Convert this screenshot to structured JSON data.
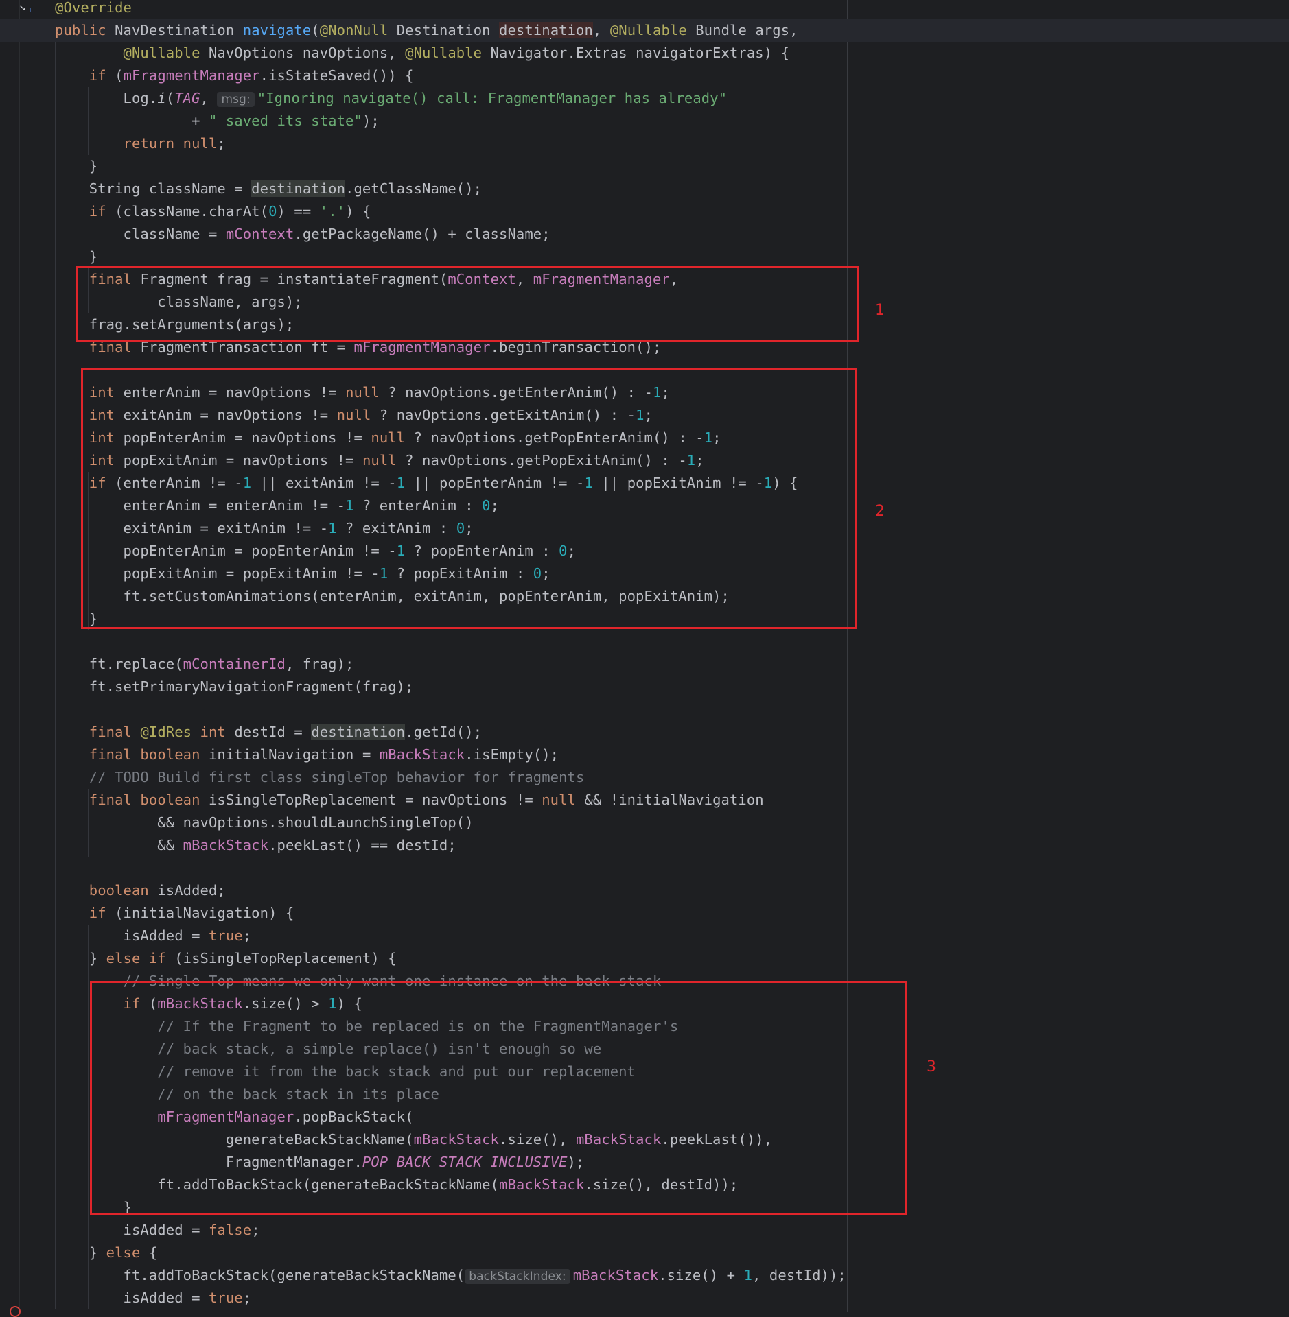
{
  "editor": {
    "gutter_icon": "override-implements-icon",
    "error_marker_icon": "error-marker-icon",
    "colors": {
      "background": "#1e1f22",
      "keyword": "#cf8e6d",
      "method": "#56a8f5",
      "annotation": "#b3ae60",
      "field": "#c77dbb",
      "string": "#6aab73",
      "number": "#2aacb8",
      "comment": "#7a7e85",
      "annotation_box": "#e0252b"
    },
    "lines": [
      {
        "tokens": [
          {
            "t": "@Override",
            "c": "an"
          }
        ]
      },
      {
        "current": true,
        "tokens": [
          {
            "t": "public ",
            "c": "kw"
          },
          {
            "t": "NavDestination "
          },
          {
            "t": "navigate",
            "c": "fn"
          },
          {
            "t": "("
          },
          {
            "t": "@NonNull",
            "c": "an"
          },
          {
            "t": " Destination "
          },
          {
            "t": "destin",
            "c": "hl-err"
          },
          {
            "caret": true
          },
          {
            "t": "ation",
            "c": "hl-err"
          },
          {
            "t": ", "
          },
          {
            "t": "@Nullable",
            "c": "an"
          },
          {
            "t": " Bundle args,"
          }
        ]
      },
      {
        "tokens": [
          {
            "t": "        "
          },
          {
            "t": "@Nullable",
            "c": "an"
          },
          {
            "t": " NavOptions navOptions, "
          },
          {
            "t": "@Nullable",
            "c": "an"
          },
          {
            "t": " Navigator.Extras navigatorExtras) {"
          }
        ]
      },
      {
        "tokens": [
          {
            "t": "    "
          },
          {
            "t": "if",
            "c": "kw"
          },
          {
            "t": " ("
          },
          {
            "t": "mFragmentManager",
            "c": "fld"
          },
          {
            "t": ".isStateSaved()) {"
          }
        ]
      },
      {
        "tokens": [
          {
            "t": "        Log."
          },
          {
            "t": "i",
            "c": "it"
          },
          {
            "t": "("
          },
          {
            "t": "TAG",
            "c": "fld it"
          },
          {
            "t": ", "
          },
          {
            "hint": "msg:"
          },
          {
            "t": "\"Ignoring navigate() call: FragmentManager has already\"",
            "c": "st"
          }
        ]
      },
      {
        "tokens": [
          {
            "t": "                + "
          },
          {
            "t": "\" saved its state\"",
            "c": "st"
          },
          {
            "t": ");"
          }
        ]
      },
      {
        "tokens": [
          {
            "t": "        "
          },
          {
            "t": "return null",
            "c": "kw"
          },
          {
            "t": ";"
          }
        ]
      },
      {
        "tokens": [
          {
            "t": "    }"
          }
        ]
      },
      {
        "tokens": [
          {
            "t": "    String className = "
          },
          {
            "t": "destination",
            "c": "hl"
          },
          {
            "t": ".getClassName();"
          }
        ]
      },
      {
        "tokens": [
          {
            "t": "    "
          },
          {
            "t": "if",
            "c": "kw"
          },
          {
            "t": " (className.charAt("
          },
          {
            "t": "0",
            "c": "num"
          },
          {
            "t": ") == "
          },
          {
            "t": "'.'",
            "c": "st"
          },
          {
            "t": ") {"
          }
        ]
      },
      {
        "tokens": [
          {
            "t": "        className = "
          },
          {
            "t": "mContext",
            "c": "fld"
          },
          {
            "t": ".getPackageName() + className;"
          }
        ]
      },
      {
        "tokens": [
          {
            "t": "    }"
          }
        ]
      },
      {
        "tokens": [
          {
            "t": "    "
          },
          {
            "t": "final ",
            "c": "kw"
          },
          {
            "t": "Fragment frag = instantiateFragment("
          },
          {
            "t": "mContext",
            "c": "fld"
          },
          {
            "t": ", "
          },
          {
            "t": "mFragmentManager",
            "c": "fld"
          },
          {
            "t": ","
          }
        ]
      },
      {
        "tokens": [
          {
            "t": "            className, args);"
          }
        ]
      },
      {
        "tokens": [
          {
            "t": "    frag.setArguments(args);"
          }
        ]
      },
      {
        "tokens": [
          {
            "t": "    "
          },
          {
            "t": "final ",
            "c": "kw"
          },
          {
            "t": "FragmentTransaction ft = "
          },
          {
            "t": "mFragmentManager",
            "c": "fld"
          },
          {
            "t": ".beginTransaction();"
          }
        ]
      },
      {
        "tokens": []
      },
      {
        "tokens": [
          {
            "t": "    "
          },
          {
            "t": "int ",
            "c": "kw"
          },
          {
            "t": "enterAnim = navOptions != "
          },
          {
            "t": "null",
            "c": "kw"
          },
          {
            "t": " ? navOptions.getEnterAnim() : -"
          },
          {
            "t": "1",
            "c": "num"
          },
          {
            "t": ";"
          }
        ]
      },
      {
        "tokens": [
          {
            "t": "    "
          },
          {
            "t": "int ",
            "c": "kw"
          },
          {
            "t": "exitAnim = navOptions != "
          },
          {
            "t": "null",
            "c": "kw"
          },
          {
            "t": " ? navOptions.getExitAnim() : -"
          },
          {
            "t": "1",
            "c": "num"
          },
          {
            "t": ";"
          }
        ]
      },
      {
        "tokens": [
          {
            "t": "    "
          },
          {
            "t": "int ",
            "c": "kw"
          },
          {
            "t": "popEnterAnim = navOptions != "
          },
          {
            "t": "null",
            "c": "kw"
          },
          {
            "t": " ? navOptions.getPopEnterAnim() : -"
          },
          {
            "t": "1",
            "c": "num"
          },
          {
            "t": ";"
          }
        ]
      },
      {
        "tokens": [
          {
            "t": "    "
          },
          {
            "t": "int ",
            "c": "kw"
          },
          {
            "t": "popExitAnim = navOptions != "
          },
          {
            "t": "null",
            "c": "kw"
          },
          {
            "t": " ? navOptions.getPopExitAnim() : -"
          },
          {
            "t": "1",
            "c": "num"
          },
          {
            "t": ";"
          }
        ]
      },
      {
        "tokens": [
          {
            "t": "    "
          },
          {
            "t": "if",
            "c": "kw"
          },
          {
            "t": " (enterAnim != -"
          },
          {
            "t": "1",
            "c": "num"
          },
          {
            "t": " || exitAnim != -"
          },
          {
            "t": "1",
            "c": "num"
          },
          {
            "t": " || popEnterAnim != -"
          },
          {
            "t": "1",
            "c": "num"
          },
          {
            "t": " || popExitAnim != -"
          },
          {
            "t": "1",
            "c": "num"
          },
          {
            "t": ") {"
          }
        ]
      },
      {
        "tokens": [
          {
            "t": "        enterAnim = enterAnim != -"
          },
          {
            "t": "1",
            "c": "num"
          },
          {
            "t": " ? enterAnim : "
          },
          {
            "t": "0",
            "c": "num"
          },
          {
            "t": ";"
          }
        ]
      },
      {
        "tokens": [
          {
            "t": "        exitAnim = exitAnim != -"
          },
          {
            "t": "1",
            "c": "num"
          },
          {
            "t": " ? exitAnim : "
          },
          {
            "t": "0",
            "c": "num"
          },
          {
            "t": ";"
          }
        ]
      },
      {
        "tokens": [
          {
            "t": "        popEnterAnim = popEnterAnim != -"
          },
          {
            "t": "1",
            "c": "num"
          },
          {
            "t": " ? popEnterAnim : "
          },
          {
            "t": "0",
            "c": "num"
          },
          {
            "t": ";"
          }
        ]
      },
      {
        "tokens": [
          {
            "t": "        popExitAnim = popExitAnim != -"
          },
          {
            "t": "1",
            "c": "num"
          },
          {
            "t": " ? popExitAnim : "
          },
          {
            "t": "0",
            "c": "num"
          },
          {
            "t": ";"
          }
        ]
      },
      {
        "tokens": [
          {
            "t": "        ft.setCustomAnimations(enterAnim, exitAnim, popEnterAnim, popExitAnim);"
          }
        ]
      },
      {
        "tokens": [
          {
            "t": "    }"
          }
        ]
      },
      {
        "tokens": []
      },
      {
        "tokens": [
          {
            "t": "    ft.replace("
          },
          {
            "t": "mContainerId",
            "c": "fld"
          },
          {
            "t": ", frag);"
          }
        ]
      },
      {
        "tokens": [
          {
            "t": "    ft.setPrimaryNavigationFragment(frag);"
          }
        ]
      },
      {
        "tokens": []
      },
      {
        "tokens": [
          {
            "t": "    "
          },
          {
            "t": "final ",
            "c": "kw"
          },
          {
            "t": "@IdRes",
            "c": "an"
          },
          {
            "t": " "
          },
          {
            "t": "int ",
            "c": "kw"
          },
          {
            "t": "destId = "
          },
          {
            "t": "destination",
            "c": "hl"
          },
          {
            "t": ".getId();"
          }
        ]
      },
      {
        "tokens": [
          {
            "t": "    "
          },
          {
            "t": "final boolean ",
            "c": "kw"
          },
          {
            "t": "initialNavigation = "
          },
          {
            "t": "mBackStack",
            "c": "fld"
          },
          {
            "t": ".isEmpty();"
          }
        ]
      },
      {
        "tokens": [
          {
            "t": "    "
          },
          {
            "t": "// TODO Build first class singleTop behavior for fragments",
            "c": "cm"
          }
        ]
      },
      {
        "tokens": [
          {
            "t": "    "
          },
          {
            "t": "final boolean ",
            "c": "kw"
          },
          {
            "t": "isSingleTopReplacement = navOptions != "
          },
          {
            "t": "null",
            "c": "kw"
          },
          {
            "t": " && !initialNavigation"
          }
        ]
      },
      {
        "tokens": [
          {
            "t": "            && navOptions.shouldLaunchSingleTop()"
          }
        ]
      },
      {
        "tokens": [
          {
            "t": "            && "
          },
          {
            "t": "mBackStack",
            "c": "fld"
          },
          {
            "t": ".peekLast() == destId;"
          }
        ]
      },
      {
        "tokens": []
      },
      {
        "tokens": [
          {
            "t": "    "
          },
          {
            "t": "boolean ",
            "c": "kw"
          },
          {
            "t": "isAdded;"
          }
        ]
      },
      {
        "tokens": [
          {
            "t": "    "
          },
          {
            "t": "if",
            "c": "kw"
          },
          {
            "t": " (initialNavigation) {"
          }
        ]
      },
      {
        "tokens": [
          {
            "t": "        isAdded = "
          },
          {
            "t": "true",
            "c": "kw"
          },
          {
            "t": ";"
          }
        ]
      },
      {
        "tokens": [
          {
            "t": "    } "
          },
          {
            "t": "else if",
            "c": "kw"
          },
          {
            "t": " (isSingleTopReplacement) {"
          }
        ]
      },
      {
        "tokens": [
          {
            "t": "        "
          },
          {
            "t": "// Single Top means we only want one instance on the back stack",
            "c": "cm strike"
          }
        ]
      },
      {
        "tokens": [
          {
            "t": "        "
          },
          {
            "t": "if",
            "c": "kw"
          },
          {
            "t": " ("
          },
          {
            "t": "mBackStack",
            "c": "fld"
          },
          {
            "t": ".size() > "
          },
          {
            "t": "1",
            "c": "num"
          },
          {
            "t": ") {"
          }
        ]
      },
      {
        "tokens": [
          {
            "t": "            "
          },
          {
            "t": "// If the Fragment to be replaced is on the FragmentManager's",
            "c": "cm"
          }
        ]
      },
      {
        "tokens": [
          {
            "t": "            "
          },
          {
            "t": "// back stack, a simple replace() isn't enough so we",
            "c": "cm"
          }
        ]
      },
      {
        "tokens": [
          {
            "t": "            "
          },
          {
            "t": "// remove it from the back stack and put our replacement",
            "c": "cm"
          }
        ]
      },
      {
        "tokens": [
          {
            "t": "            "
          },
          {
            "t": "// on the back stack in its place",
            "c": "cm"
          }
        ]
      },
      {
        "tokens": [
          {
            "t": "            "
          },
          {
            "t": "mFragmentManager",
            "c": "fld"
          },
          {
            "t": ".popBackStack("
          }
        ]
      },
      {
        "tokens": [
          {
            "t": "                    generateBackStackName("
          },
          {
            "t": "mBackStack",
            "c": "fld"
          },
          {
            "t": ".size(), "
          },
          {
            "t": "mBackStack",
            "c": "fld"
          },
          {
            "t": ".peekLast()),"
          }
        ]
      },
      {
        "tokens": [
          {
            "t": "                    FragmentManager."
          },
          {
            "t": "POP_BACK_STACK_INCLUSIVE",
            "c": "fld it"
          },
          {
            "t": ");"
          }
        ]
      },
      {
        "tokens": [
          {
            "t": "            ft.addToBackStack(generateBackStackName("
          },
          {
            "t": "mBackStack",
            "c": "fld"
          },
          {
            "t": ".size(), destId));"
          }
        ]
      },
      {
        "tokens": [
          {
            "t": "        }"
          }
        ]
      },
      {
        "tokens": [
          {
            "t": "        isAdded = "
          },
          {
            "t": "false",
            "c": "kw"
          },
          {
            "t": ";"
          }
        ]
      },
      {
        "tokens": [
          {
            "t": "    } "
          },
          {
            "t": "else",
            "c": "kw"
          },
          {
            "t": " {"
          }
        ]
      },
      {
        "tokens": [
          {
            "t": "        ft.addToBackStack(generateBackStackName("
          },
          {
            "hint": "backStackIndex:"
          },
          {
            "t": "mBackStack",
            "c": "fld"
          },
          {
            "t": ".size() + "
          },
          {
            "t": "1",
            "c": "num"
          },
          {
            "t": ", destId));"
          }
        ]
      },
      {
        "tokens": [
          {
            "t": "        isAdded = "
          },
          {
            "t": "true",
            "c": "kw"
          },
          {
            "t": ";"
          }
        ]
      }
    ]
  },
  "annotations": [
    {
      "label": "1"
    },
    {
      "label": "2"
    },
    {
      "label": "3"
    }
  ]
}
